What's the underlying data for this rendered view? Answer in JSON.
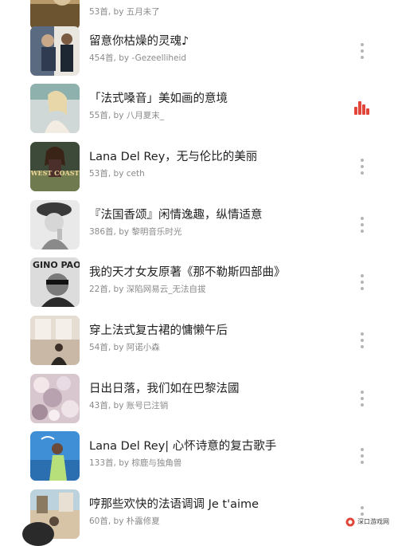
{
  "colors": {
    "accent": "#e2463b",
    "title": "#1f1f1f",
    "subtitle": "#8a8a8a",
    "dots": "#b5b5b5"
  },
  "playlists": [
    {
      "title": "",
      "meta": "53首, by 五月未了",
      "state": "more"
    },
    {
      "title": "留意你枯燥的灵魂♪",
      "meta": "454首, by -Gezeelliheid",
      "state": "more"
    },
    {
      "title": "「法式嗓音」美如画的意境",
      "meta": "55首, by 八月夏末_",
      "state": "playing"
    },
    {
      "title": "Lana Del Rey，无与伦比的美丽",
      "meta": "53首, by ceth",
      "state": "more",
      "cover_text": "WEST COAST"
    },
    {
      "title": "『法国香颂』闲情逸趣，纵情适意",
      "meta": "386首, by 黎明音乐时光",
      "state": "more"
    },
    {
      "title": "我的天才女友原著《那不勒斯四部曲》",
      "meta": "22首, by 深陷网易云_无法自拔",
      "state": "more",
      "cover_text": "GINO PAOLI"
    },
    {
      "title": "穿上法式复古裙的慵懒午后",
      "meta": "54首, by 阿诺小森",
      "state": "more"
    },
    {
      "title": "日出日落，我们如在巴黎法國",
      "meta": "43首, by 账号已注销",
      "state": "more"
    },
    {
      "title": "Lana Del Rey| 心怀诗意的复古歌手",
      "meta": "133首, by 棕鹿与独角兽",
      "state": "more"
    },
    {
      "title": "哼那些欢快的法语调调 Je t'aime",
      "meta": "60首, by 朴露修夏",
      "state": "more"
    }
  ],
  "icons": {
    "more": "more-vertical-icon",
    "playing": "now-playing-equalizer-icon"
  },
  "watermark": {
    "text": "深口游戏网"
  }
}
